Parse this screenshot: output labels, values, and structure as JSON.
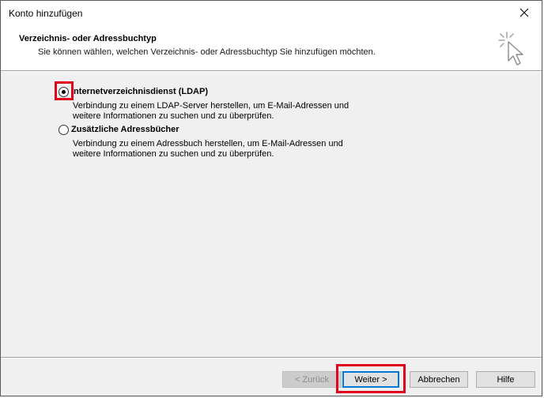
{
  "window": {
    "title": "Konto hinzufügen"
  },
  "header": {
    "title": "Verzeichnis- oder Adressbuchtyp",
    "subtitle": "Sie können wählen, welchen Verzeichnis- oder Adressbuchtyp Sie hinzufügen möchten.",
    "icon": "wizard-cursor-icon"
  },
  "options": [
    {
      "label": "Internetverzeichnisdienst (LDAP)",
      "description_line1": "Verbindung zu einem LDAP-Server herstellen, um E-Mail-Adressen und",
      "description_line2": "weitere Informationen zu suchen und zu überprüfen.",
      "checked": true
    },
    {
      "label": "Zusätzliche Adressbücher",
      "description_line1": "Verbindung zu einem Adressbuch herstellen, um E-Mail-Adressen und",
      "description_line2": "weitere Informationen zu suchen und zu überprüfen.",
      "checked": false
    }
  ],
  "buttons": {
    "back": "< Zurück",
    "next": "Weiter >",
    "cancel": "Abbrechen",
    "help": "Hilfe"
  },
  "colors": {
    "highlight": "#e0001b",
    "default_button_border": "#0078d7"
  }
}
